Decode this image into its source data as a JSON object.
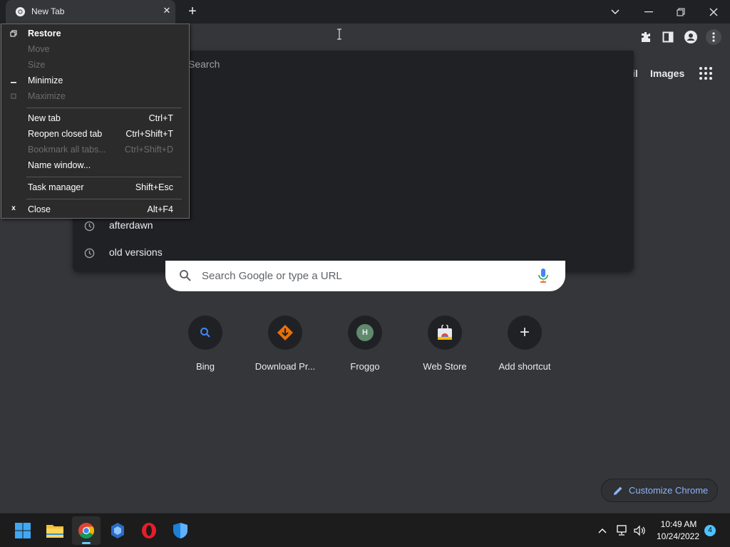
{
  "tab": {
    "title": "New Tab",
    "close_glyph": "✕"
  },
  "omnibox": {
    "search_label": "Search",
    "suggestions": [
      {
        "icon": "history-icon",
        "text": "afterdawn"
      },
      {
        "icon": "history-icon",
        "text": "old versions"
      }
    ]
  },
  "google_links": {
    "gmail_partial": "il",
    "images": "Images"
  },
  "search": {
    "placeholder": "Search Google or type a URL"
  },
  "shortcuts": [
    {
      "label": "Bing",
      "icon": "bing-search-icon"
    },
    {
      "label": "Download Pr...",
      "icon": "download-icon"
    },
    {
      "label": "Froggo",
      "icon": "froggo-avatar-icon",
      "letter": "H"
    },
    {
      "label": "Web Store",
      "icon": "web-store-icon"
    },
    {
      "label": "Add shortcut",
      "icon": "plus-icon",
      "glyph": "+"
    }
  ],
  "customize": {
    "label": "Customize Chrome"
  },
  "system_menu": {
    "items": [
      {
        "label": "Restore",
        "shortcut": "",
        "enabled": true,
        "bold": true,
        "icon": "restore-icon"
      },
      {
        "label": "Move",
        "shortcut": "",
        "enabled": false
      },
      {
        "label": "Size",
        "shortcut": "",
        "enabled": false
      },
      {
        "label": "Minimize",
        "shortcut": "",
        "enabled": true,
        "icon": "minimize-icon"
      },
      {
        "label": "Maximize",
        "shortcut": "",
        "enabled": false,
        "icon": "maximize-icon"
      },
      {
        "label": "New tab",
        "shortcut": "Ctrl+T",
        "enabled": true
      },
      {
        "label": "Reopen closed tab",
        "shortcut": "Ctrl+Shift+T",
        "enabled": true
      },
      {
        "label": "Bookmark all tabs...",
        "shortcut": "Ctrl+Shift+D",
        "enabled": false
      },
      {
        "label": "Name window...",
        "shortcut": "",
        "enabled": true
      },
      {
        "label": "Task manager",
        "shortcut": "Shift+Esc",
        "enabled": true
      },
      {
        "label": "Close",
        "shortcut": "Alt+F4",
        "enabled": true,
        "icon": "close-icon",
        "glyph": "x"
      }
    ]
  },
  "taskbar": {
    "apps": [
      "start-icon",
      "file-explorer-icon",
      "chrome-icon",
      "azure-data-studio-icon",
      "opera-icon",
      "windows-security-icon"
    ],
    "time": "10:49 AM",
    "date": "10/24/2022",
    "notification_count": "4"
  },
  "colors": {
    "background": "#35363a",
    "titlebar": "#202124",
    "accent_blue": "#8ab4f8",
    "taskbar": "#1c1c1c",
    "taskbar_indicator": "#60cdff"
  }
}
